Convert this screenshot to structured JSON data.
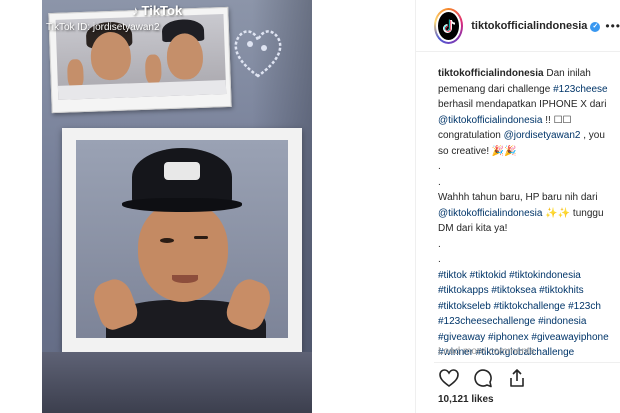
{
  "media": {
    "watermark_app": "TikTok",
    "watermark_id": "TikTok ID: jordisetyawan2"
  },
  "post": {
    "username": "tiktokofficialindonesia",
    "more": "•••",
    "caption_user": "tiktokofficialindonesia",
    "caption_lines": [
      {
        "parts": [
          {
            "t": " Dan inilah",
            "k": "text"
          }
        ]
      },
      {
        "parts": [
          {
            "t": "pemenang dari challenge ",
            "k": "text"
          },
          {
            "t": "#123cheese",
            "k": "tag"
          }
        ]
      },
      {
        "parts": [
          {
            "t": "berhasil mendapatkan IPHONE X dari",
            "k": "text"
          }
        ]
      },
      {
        "parts": [
          {
            "t": "@tiktokofficialindonesia",
            "k": "tag"
          },
          {
            "t": " !! ☐☐",
            "k": "text"
          }
        ]
      },
      {
        "parts": [
          {
            "t": "congratulation ",
            "k": "text"
          },
          {
            "t": "@jordisetyawan2",
            "k": "tag"
          },
          {
            "t": " , you",
            "k": "text"
          }
        ]
      },
      {
        "parts": [
          {
            "t": "so creative! 🎉🎉",
            "k": "text"
          }
        ]
      },
      {
        "parts": [
          {
            "t": ".",
            "k": "text"
          }
        ]
      },
      {
        "parts": [
          {
            "t": ".",
            "k": "text"
          }
        ]
      },
      {
        "parts": [
          {
            "t": "Wahhh tahun baru, HP baru nih dari",
            "k": "text"
          }
        ]
      },
      {
        "parts": [
          {
            "t": "@tiktokofficialindonesia",
            "k": "tag"
          },
          {
            "t": " ✨✨ tunggu",
            "k": "text"
          }
        ]
      },
      {
        "parts": [
          {
            "t": "DM dari kita ya!",
            "k": "text"
          }
        ]
      },
      {
        "parts": [
          {
            "t": ".",
            "k": "text"
          }
        ]
      },
      {
        "parts": [
          {
            "t": ".",
            "k": "text"
          }
        ]
      },
      {
        "parts": [
          {
            "t": "#tiktok #tiktokid #tiktokindonesia",
            "k": "tag"
          }
        ]
      },
      {
        "parts": [
          {
            "t": "#tiktokapps #tiktoksea #tiktokhits",
            "k": "tag"
          }
        ]
      },
      {
        "parts": [
          {
            "t": "#tiktokseleb #tiktokchallenge #123ch",
            "k": "tag"
          }
        ]
      },
      {
        "parts": [
          {
            "t": "#123cheesechallenge #indonesia",
            "k": "tag"
          }
        ]
      },
      {
        "parts": [
          {
            "t": "#giveaway #iphonex #giveawayiphone",
            "k": "tag"
          }
        ]
      },
      {
        "parts": [
          {
            "t": "#winner #tiktokglobalchallenge",
            "k": "tag"
          }
        ]
      }
    ],
    "load_more": "Load more comments",
    "likes": "10,121 likes",
    "icons": [
      "heart-icon",
      "comment-icon",
      "share-icon"
    ]
  },
  "colors": {
    "link": "#003569",
    "verified": "#3897f0"
  }
}
